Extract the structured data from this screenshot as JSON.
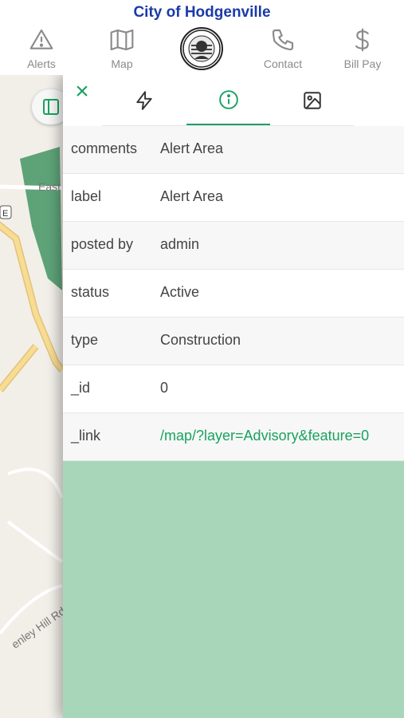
{
  "header": {
    "title": "City of Hodgenville",
    "nav": [
      {
        "icon": "alert-triangle-icon",
        "label": "Alerts"
      },
      {
        "icon": "map-icon",
        "label": "Map"
      },
      {
        "icon": "city-seal-logo",
        "label": ""
      },
      {
        "icon": "phone-icon",
        "label": "Contact"
      },
      {
        "icon": "dollar-icon",
        "label": "Bill Pay"
      }
    ],
    "logo_text": "CITY OF HODGENVILLE · EST. 1818"
  },
  "map": {
    "labels": [
      "East",
      "enley Hill Rd."
    ],
    "route_badge": "E"
  },
  "panel": {
    "close_label": "×",
    "tabs": [
      {
        "icon": "lightning-icon",
        "active": false
      },
      {
        "icon": "info-icon",
        "active": true
      },
      {
        "icon": "image-icon",
        "active": false
      }
    ],
    "rows": [
      {
        "key": "comments",
        "value": "Alert Area"
      },
      {
        "key": "label",
        "value": "Alert Area"
      },
      {
        "key": "posted by",
        "value": "admin"
      },
      {
        "key": "status",
        "value": "Active"
      },
      {
        "key": "type",
        "value": "Construction"
      },
      {
        "key": "_id",
        "value": "0"
      },
      {
        "key": "_link",
        "value": "/map/?layer=Advisory&feature=0"
      }
    ]
  },
  "colors": {
    "accent": "#1aa260",
    "title_blue": "#1a3aa8",
    "panel_green": "#a7d7b8"
  }
}
